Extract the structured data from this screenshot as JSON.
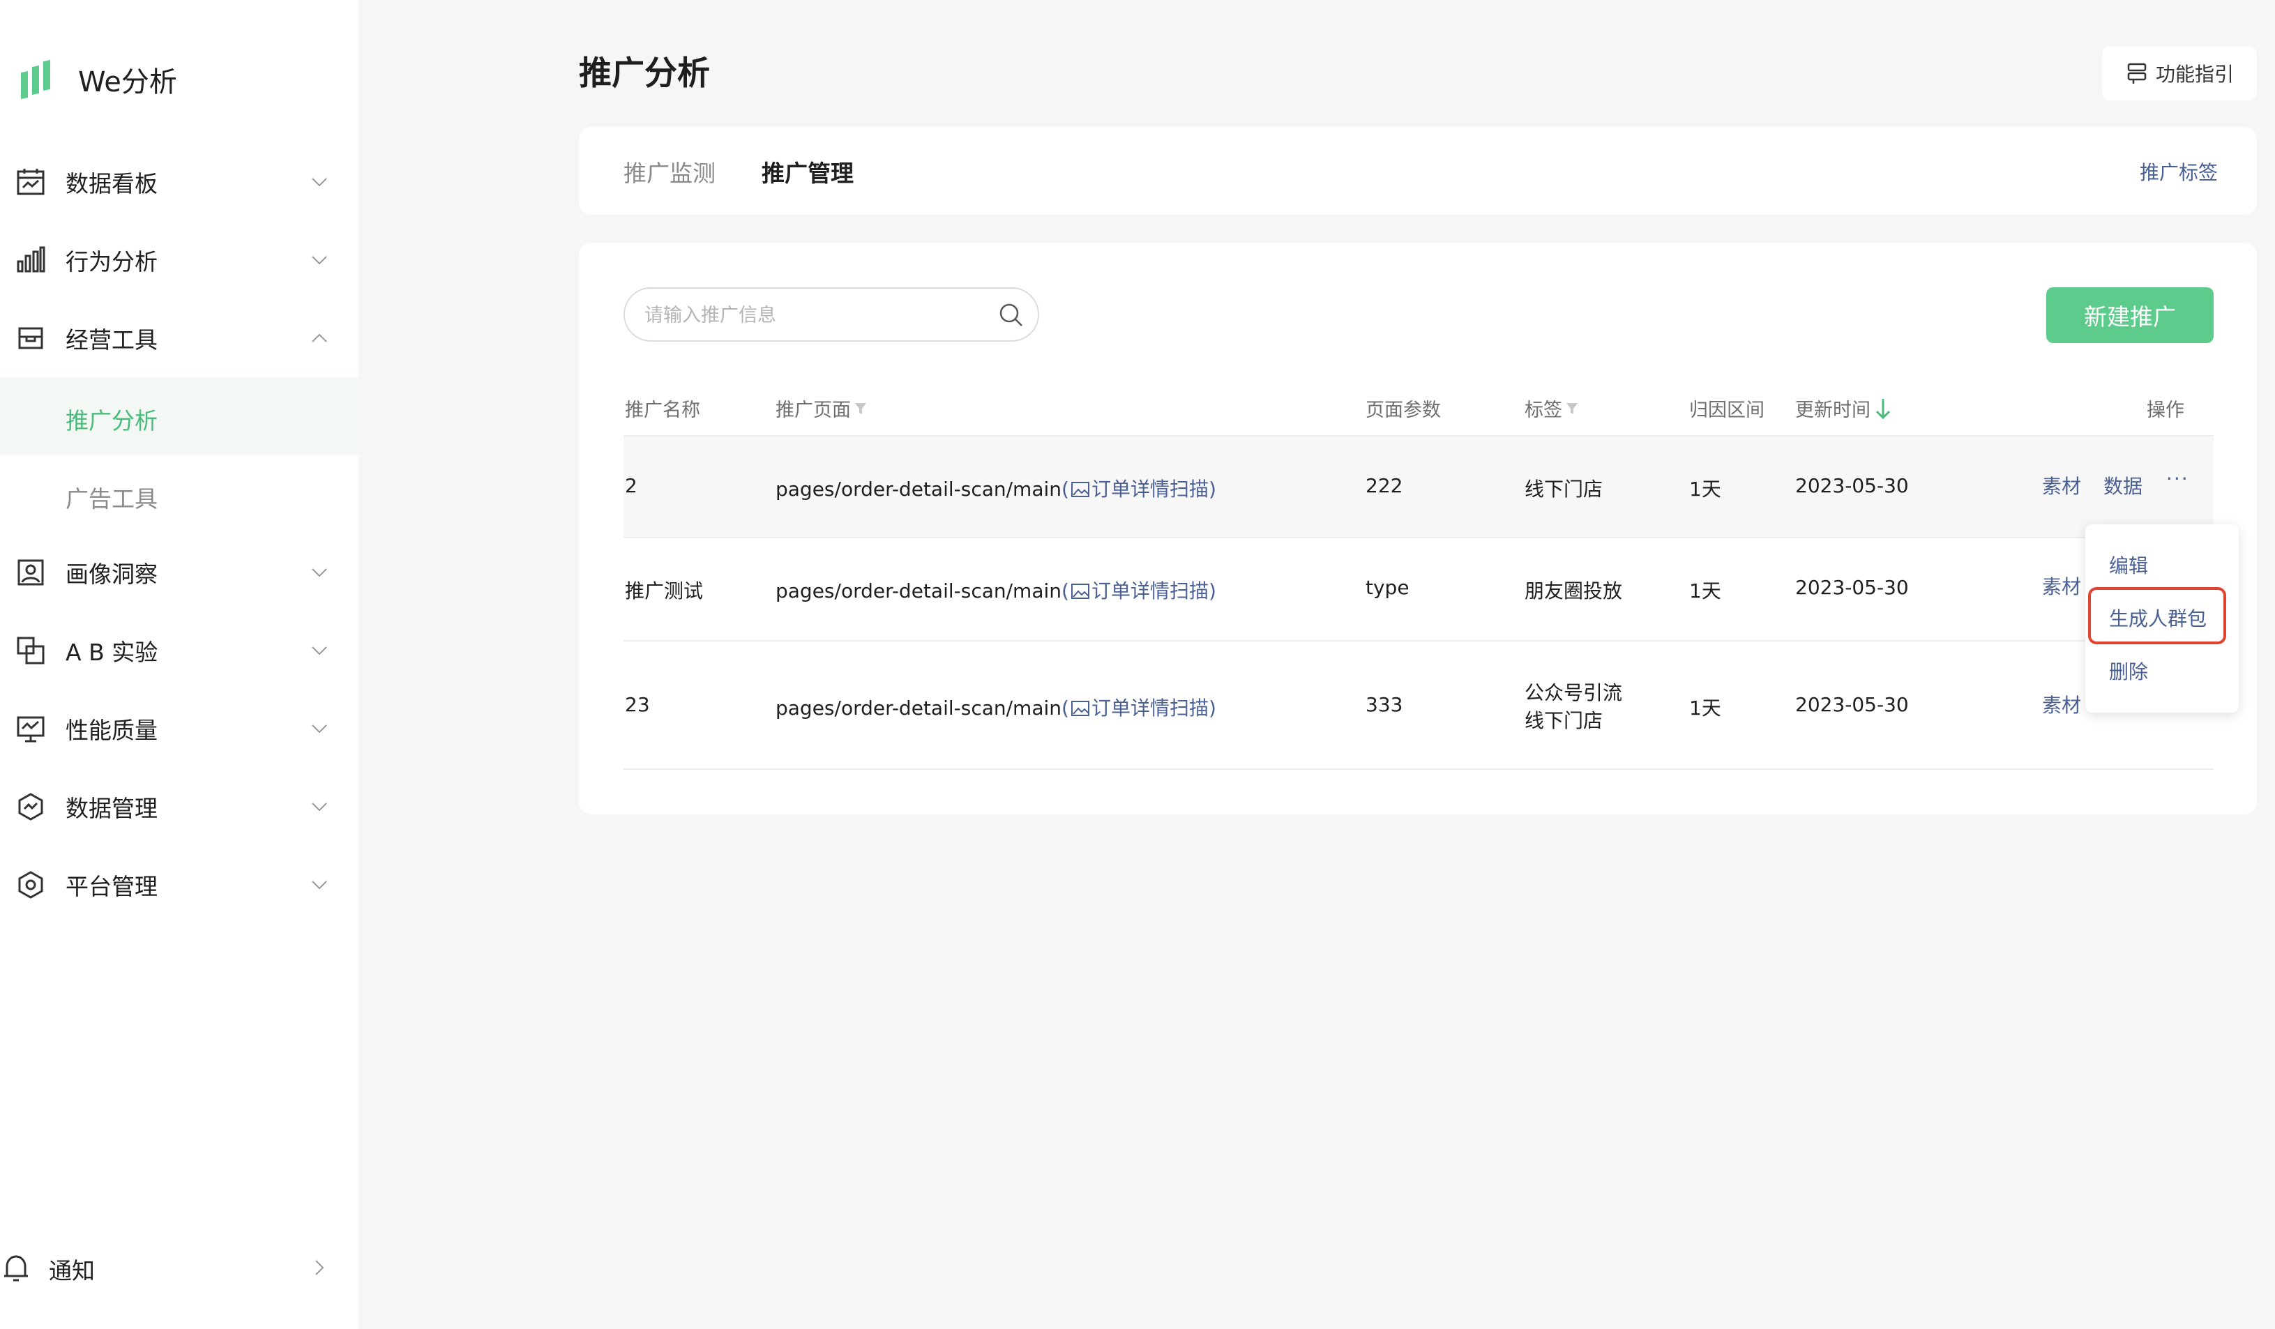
{
  "app": {
    "name": "We分析"
  },
  "sidebar": {
    "items": [
      {
        "label": "数据看板",
        "icon": "dashboard-icon",
        "expanded": false
      },
      {
        "label": "行为分析",
        "icon": "bar-chart-icon",
        "expanded": false
      },
      {
        "label": "经营工具",
        "icon": "store-icon",
        "expanded": true,
        "children": [
          {
            "label": "推广分析",
            "active": true
          },
          {
            "label": "广告工具",
            "active": false
          }
        ]
      },
      {
        "label": "画像洞察",
        "icon": "portrait-icon",
        "expanded": false
      },
      {
        "label": "A B 实验",
        "icon": "ab-test-icon",
        "expanded": false
      },
      {
        "label": "性能质量",
        "icon": "monitor-icon",
        "expanded": false
      },
      {
        "label": "数据管理",
        "icon": "data-manage-icon",
        "expanded": false
      },
      {
        "label": "平台管理",
        "icon": "settings-hex-icon",
        "expanded": false
      }
    ],
    "notify": {
      "label": "通知",
      "icon": "bell-icon"
    }
  },
  "header": {
    "title": "推广分析",
    "guide_button": "功能指引"
  },
  "tabs": [
    {
      "label": "推广监测",
      "active": false
    },
    {
      "label": "推广管理",
      "active": true
    }
  ],
  "tab_link": "推广标签",
  "toolbar": {
    "search_placeholder": "请输入推广信息",
    "new_button": "新建推广"
  },
  "table": {
    "columns": [
      "推广名称",
      "推广页面",
      "页面参数",
      "标签",
      "归因区间",
      "更新时间",
      "操作"
    ],
    "rows": [
      {
        "name": "2",
        "page": "pages/order-detail-scan/main",
        "page_alias": "订单详情扫描",
        "param": "222",
        "tags": [
          "线下门店"
        ],
        "interval": "1天",
        "updated": "2023-05-30",
        "actions": [
          "素材",
          "数据",
          "···"
        ]
      },
      {
        "name": "推广测试",
        "page": "pages/order-detail-scan/main",
        "page_alias": "订单详情扫描",
        "param": "type",
        "tags": [
          "朋友圈投放"
        ],
        "interval": "1天",
        "updated": "2023-05-30",
        "actions": [
          "素材"
        ]
      },
      {
        "name": "23",
        "page": "pages/order-detail-scan/main",
        "page_alias": "订单详情扫描",
        "param": "333",
        "tags": [
          "公众号引流",
          "线下门店"
        ],
        "interval": "1天",
        "updated": "2023-05-30",
        "actions": [
          "素材"
        ]
      }
    ]
  },
  "dropdown": {
    "items": [
      "编辑",
      "生成人群包",
      "删除"
    ],
    "highlighted": "生成人群包"
  },
  "colors": {
    "brand_green": "#5dcb8b",
    "link": "#4a5f93",
    "highlight_border": "#e0432f"
  }
}
